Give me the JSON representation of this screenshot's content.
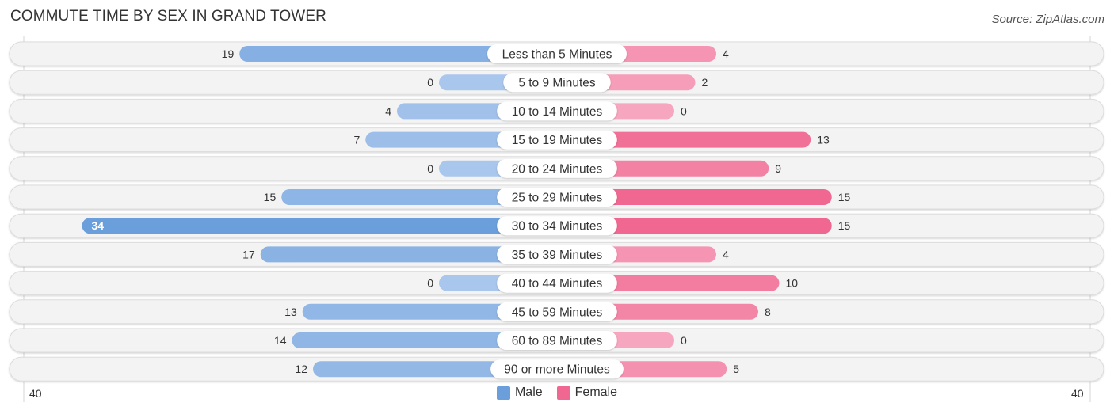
{
  "header": {
    "title": "COMMUTE TIME BY SEX IN GRAND TOWER",
    "source": "Source: ZipAtlas.com"
  },
  "colors": {
    "male": "#6a9fdc",
    "female": "#f06892",
    "male_light": "#a9c6ec",
    "female_light": "#f7a6bf",
    "row_bg": "#f3f3f3"
  },
  "legend": [
    {
      "label": "Male",
      "color": "#6a9fdc"
    },
    {
      "label": "Female",
      "color": "#f06892"
    }
  ],
  "axis": {
    "left_label": "40",
    "right_label": "40"
  },
  "chart_data": {
    "type": "bar",
    "orientation": "horizontal-diverging",
    "title": "COMMUTE TIME BY SEX IN GRAND TOWER",
    "categories": [
      "Less than 5 Minutes",
      "5 to 9 Minutes",
      "10 to 14 Minutes",
      "15 to 19 Minutes",
      "20 to 24 Minutes",
      "25 to 29 Minutes",
      "30 to 34 Minutes",
      "35 to 39 Minutes",
      "40 to 44 Minutes",
      "45 to 59 Minutes",
      "60 to 89 Minutes",
      "90 or more Minutes"
    ],
    "series": [
      {
        "name": "Male",
        "values": [
          19,
          0,
          4,
          7,
          0,
          15,
          34,
          17,
          0,
          13,
          14,
          12
        ]
      },
      {
        "name": "Female",
        "values": [
          4,
          2,
          0,
          13,
          9,
          15,
          15,
          4,
          10,
          8,
          0,
          5
        ]
      }
    ],
    "xlim": [
      -40,
      40
    ],
    "xtick_labels": [
      "40",
      "40"
    ],
    "legend_position": "bottom-center",
    "grid": false
  }
}
